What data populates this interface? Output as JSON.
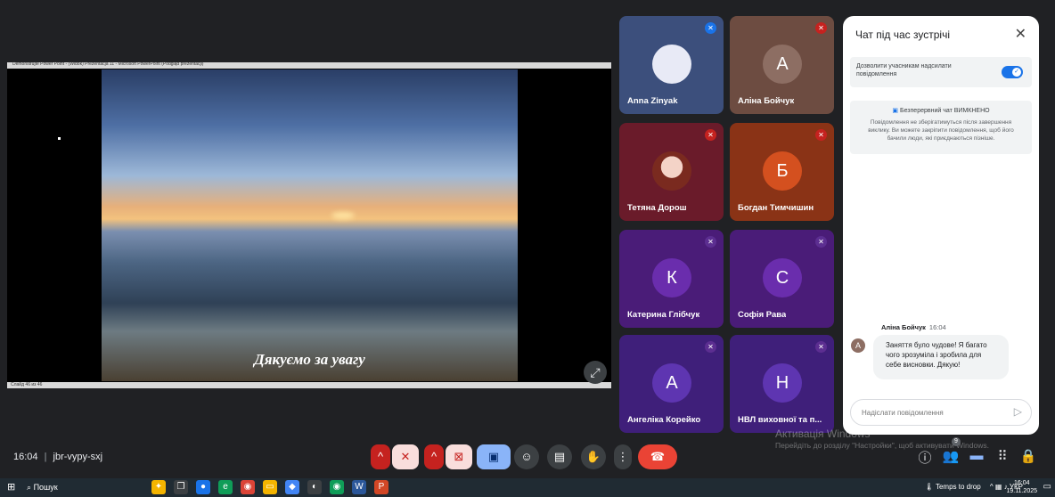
{
  "presentation": {
    "window_title": "Demonstrujte Power Point - (Widok) Prezentacja 11 - Microsoft PowerPoint (Podgląd prezentacji)",
    "status_text": "Слайд 46 из 46",
    "caption": "Дякуємо за увагу"
  },
  "tiles": [
    {
      "name": "Anna Zinyak",
      "initial": "",
      "bg": "#3c4f7c",
      "avatar_bg": "#e8eaf6",
      "mic": "#1a73e8"
    },
    {
      "name": "Аліна Бойчук",
      "initial": "А",
      "bg": "#6d4c41",
      "avatar_bg": "#8d6e63",
      "mic": "#c5221f"
    },
    {
      "name": "Тетяна Дорош",
      "initial": "",
      "bg": "#6a1b2a",
      "avatar_bg": "#f4d3c7",
      "mic": "#c5221f"
    },
    {
      "name": "Богдан Тимчишин",
      "initial": "Б",
      "bg": "#8a3316",
      "avatar_bg": "#d4501f",
      "mic": "#c5221f"
    },
    {
      "name": "Катерина Глібчук",
      "initial": "К",
      "bg": "#4a1c78",
      "avatar_bg": "#6a2dad",
      "mic": "#5c2e91"
    },
    {
      "name": "Софія Рава",
      "initial": "С",
      "bg": "#4a1c78",
      "avatar_bg": "#6a2dad",
      "mic": "#5c2e91"
    },
    {
      "name": "Ангеліка Корейко",
      "initial": "А",
      "bg": "#3f1f7a",
      "avatar_bg": "#5e35b1",
      "mic": "#5c2e91"
    },
    {
      "name": "НВЛ виховної та п...",
      "initial": "Н",
      "bg": "#3f1f7a",
      "avatar_bg": "#5e35b1",
      "mic": "#5c2e91"
    }
  ],
  "chat": {
    "title": "Чат під час зустрічі",
    "allow_label": "Дозволити учасникам надсилати повідомлення",
    "notice_title": "Безперервний чат ВИМКНЕНО",
    "notice_body": "Повідомлення не зберігатимуться після завершення виклику. Ви можете закріпити повідомлення, щоб його бачили люди, які приєднаються пізніше.",
    "message": {
      "sender": "Аліна Бойчук",
      "time": "16:04",
      "avatar": "А",
      "text": "Заняття було чудове! Я багато чого зрозуміла і зробила для себе висновки. Дякую!"
    },
    "input_placeholder": "Надіслати повідомлення"
  },
  "bottom": {
    "time": "16:04",
    "separator": "|",
    "meeting_code": "jbr-vypy-sxj",
    "watermark_title": "Активація Windows",
    "watermark_text": "Перейдіть до розділу \"Настройки\", щоб активувати Windows.",
    "badge_count": "9"
  },
  "taskbar": {
    "search_label": "Пошук",
    "tray_weather": "Temps to drop",
    "tray_lang": "УКР",
    "clock_time": "16:04",
    "clock_date": "19.11.2025"
  }
}
